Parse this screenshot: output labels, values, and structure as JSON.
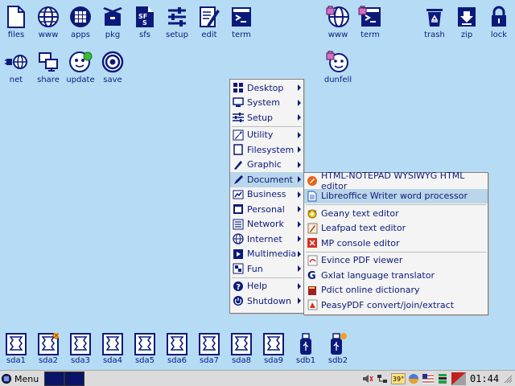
{
  "desktop": {
    "top_icons": [
      {
        "label": "files",
        "icon": "file-icon"
      },
      {
        "label": "www",
        "icon": "globe-icon"
      },
      {
        "label": "apps",
        "icon": "apps-grid-icon"
      },
      {
        "label": "pkg",
        "icon": "package-box-icon"
      },
      {
        "label": "sfs",
        "icon": "sfs-file-icon"
      },
      {
        "label": "setup",
        "icon": "sliders-icon"
      },
      {
        "label": "edit",
        "icon": "edit-document-icon"
      },
      {
        "label": "term",
        "icon": "terminal-icon"
      },
      {
        "label": "www",
        "icon": "locked-globe-icon"
      },
      {
        "label": "term",
        "icon": "locked-terminal-icon"
      },
      {
        "label": "trash",
        "icon": "recycle-bin-icon"
      },
      {
        "label": "zip",
        "icon": "zip-download-icon"
      },
      {
        "label": "lock",
        "icon": "padlock-icon"
      }
    ],
    "second_row_icons": [
      {
        "label": "net",
        "icon": "network-plug-icon"
      },
      {
        "label": "share",
        "icon": "share-monitors-icon"
      },
      {
        "label": "update",
        "icon": "update-face-icon"
      },
      {
        "label": "save",
        "icon": "save-target-icon"
      },
      {
        "label": "dunfell",
        "icon": "locked-face-icon"
      }
    ],
    "drives": [
      {
        "label": "sda1"
      },
      {
        "label": "sda2"
      },
      {
        "label": "sda3"
      },
      {
        "label": "sda4"
      },
      {
        "label": "sda5"
      },
      {
        "label": "sda6"
      },
      {
        "label": "sda7"
      },
      {
        "label": "sda8"
      },
      {
        "label": "sda9"
      },
      {
        "label": "sdb1"
      },
      {
        "label": "sdb2"
      }
    ]
  },
  "main_menu": {
    "items": [
      {
        "label": "Desktop",
        "icon": "desktop-grid-icon"
      },
      {
        "label": "System",
        "icon": "system-monitor-icon"
      },
      {
        "label": "Setup",
        "icon": "setup-sliders-icon"
      },
      {
        "label": "Utility",
        "icon": "utility-wrench-icon"
      },
      {
        "label": "Filesystem",
        "icon": "filesystem-icon"
      },
      {
        "label": "Graphic",
        "icon": "graphic-brush-icon"
      },
      {
        "label": "Document",
        "icon": "document-pen-icon"
      },
      {
        "label": "Business",
        "icon": "business-chart-icon"
      },
      {
        "label": "Personal",
        "icon": "personal-calendar-icon"
      },
      {
        "label": "Network",
        "icon": "network-icon"
      },
      {
        "label": "Internet",
        "icon": "internet-globe-icon"
      },
      {
        "label": "Multimedia",
        "icon": "multimedia-icon"
      },
      {
        "label": "Fun",
        "icon": "fun-puzzle-icon"
      },
      {
        "label": "Help",
        "icon": "help-icon"
      },
      {
        "label": "Shutdown",
        "icon": "shutdown-icon"
      }
    ]
  },
  "document_submenu": {
    "items": [
      {
        "label": "HTML-NOTEPAD WYSIWYG HTML editor",
        "icon": "html-notepad-icon"
      },
      {
        "label": "Libreoffice Writer word processor",
        "icon": "writer-icon"
      },
      {
        "label": "Geany text editor",
        "icon": "geany-icon"
      },
      {
        "label": "Leafpad text editor",
        "icon": "leafpad-icon"
      },
      {
        "label": "MP console editor",
        "icon": "mp-editor-icon"
      },
      {
        "label": "Evince PDF viewer",
        "icon": "evince-icon"
      },
      {
        "label": "Gxlat language translator",
        "icon": "gxlat-icon"
      },
      {
        "label": "Pdict online dictionary",
        "icon": "pdict-icon"
      },
      {
        "label": "PeasyPDF convert/join/extract",
        "icon": "peasypdf-icon"
      }
    ]
  },
  "taskbar": {
    "menu_label": "Menu",
    "tray_temp": "39°",
    "clock": "01:44"
  },
  "colors": {
    "desktop_bg": "#b6dcf5",
    "icon_blue": "#0b1a7a",
    "menu_highlight": "#b9d6ea",
    "taskbar_bg": "#dbdbdb"
  }
}
